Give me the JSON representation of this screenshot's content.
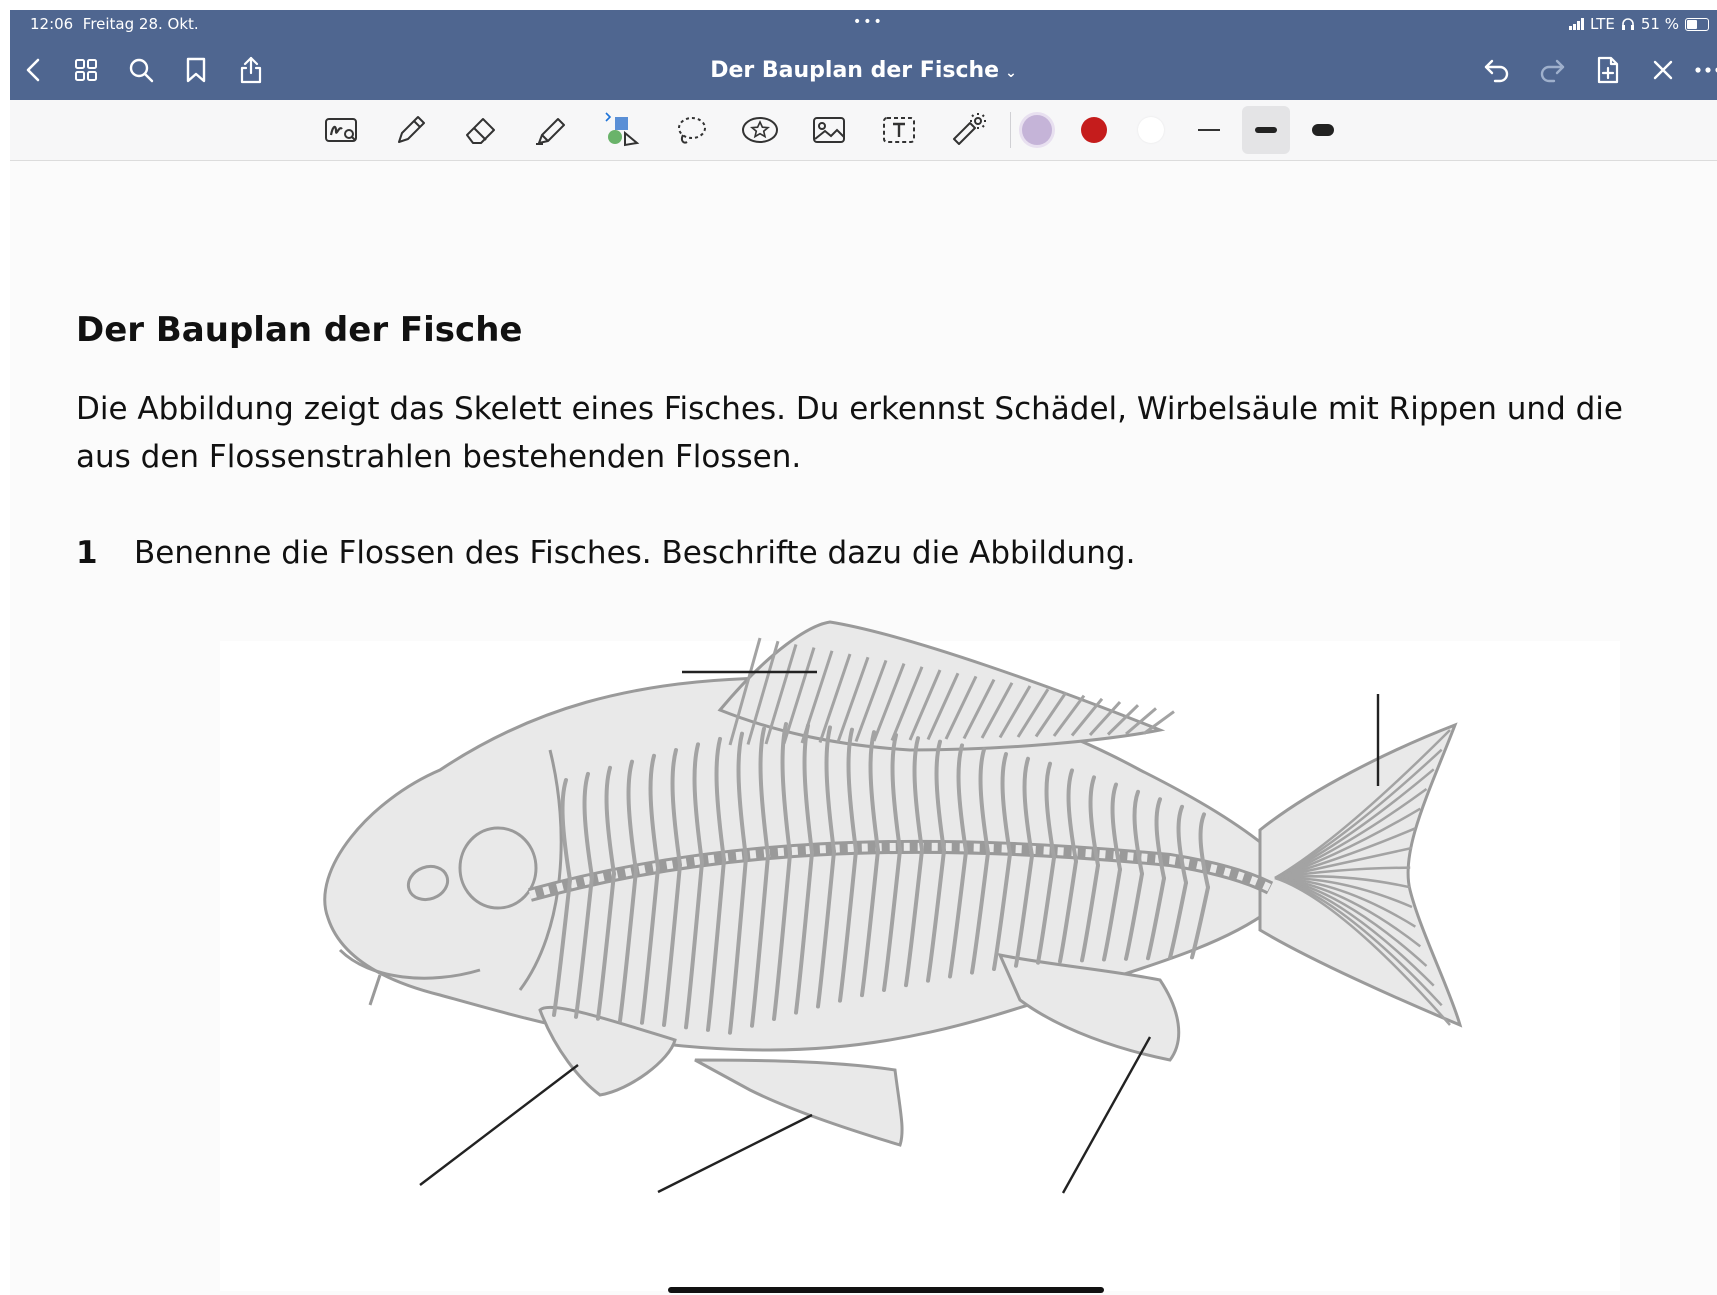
{
  "status_bar": {
    "time": "12:06",
    "date": "Freitag 28. Okt.",
    "network": "LTE",
    "battery": "51 %",
    "center_dots": "•••"
  },
  "nav": {
    "document_title": "Der Bauplan der Fische",
    "icons": [
      "back-icon",
      "grid-icon",
      "search-icon",
      "bookmark-icon",
      "share-icon",
      "undo-icon",
      "redo-icon",
      "add-page-icon",
      "close-icon",
      "more-icon"
    ]
  },
  "toolbar": {
    "tools": [
      "zoom-write-tool",
      "pen-tool",
      "eraser-tool",
      "highlighter-tool",
      "shapes-tool",
      "lasso-tool",
      "sticker-tool",
      "image-tool",
      "text-tool",
      "laser-tool"
    ],
    "colors": [
      "#c5b4d8",
      "#c51c1c",
      "#ffffff"
    ],
    "stroke_widths": [
      "thin",
      "medium",
      "thick"
    ],
    "selected_stroke": "medium"
  },
  "document": {
    "heading": "Der Bauplan der Fische",
    "intro_line1": "Die Abbildung zeigt das Skelett eines Fisches. Du erkennst Schädel, Wirbelsäule mit Rippen und die",
    "intro_line2": "aus den Flossenstrahlen bestehenden Flossen.",
    "task_number": "1",
    "task_text": "Benenne die Flossen des Fisches. Beschrifte dazu die Abbildung."
  }
}
